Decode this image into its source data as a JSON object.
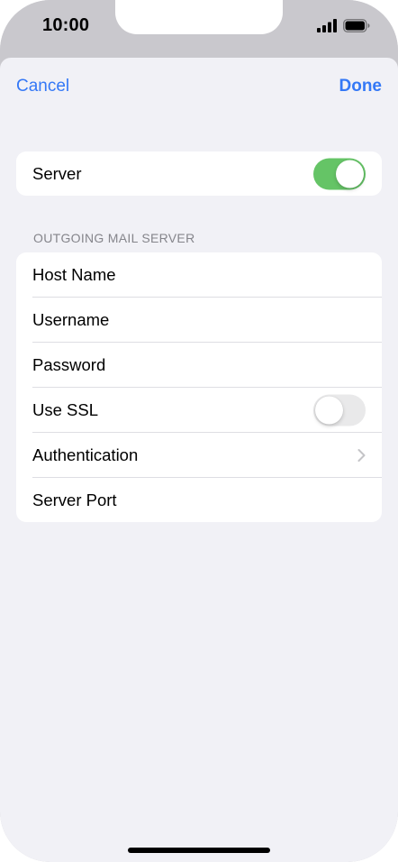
{
  "status_bar": {
    "time": "10:00",
    "signal_icon": "cellular-signal-icon",
    "battery_icon": "battery-icon"
  },
  "nav": {
    "cancel_label": "Cancel",
    "done_label": "Done"
  },
  "server_group": {
    "label": "Server",
    "toggle_on": true
  },
  "outgoing": {
    "header": "OUTGOING MAIL SERVER",
    "rows": [
      {
        "label": "Host Name"
      },
      {
        "label": "Username"
      },
      {
        "label": "Password"
      },
      {
        "label": "Use SSL",
        "toggle_on": false
      },
      {
        "label": "Authentication",
        "icon": "chevron-right-icon"
      },
      {
        "label": "Server Port"
      }
    ]
  },
  "colors": {
    "accent": "#3478f6",
    "toggle_on": "#65c466",
    "toggle_off": "#e9e9ea",
    "background": "#f1f1f6"
  }
}
